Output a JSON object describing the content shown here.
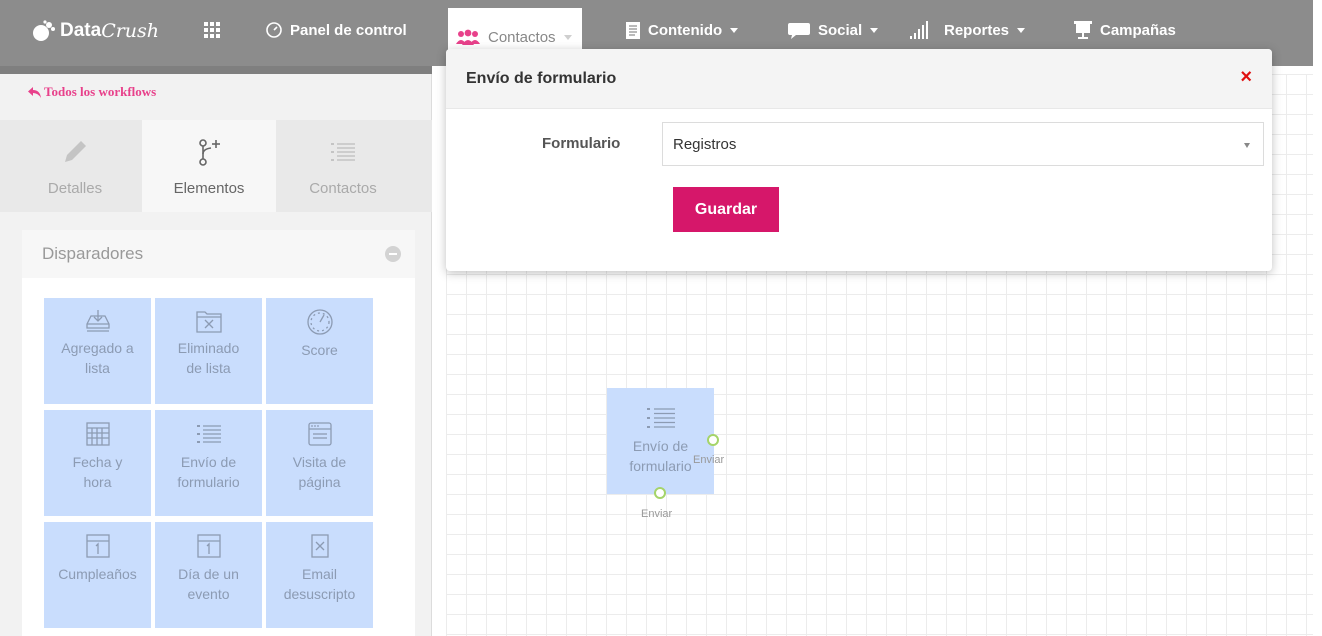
{
  "brand": {
    "name_a": "Data",
    "name_b": "Crush"
  },
  "nav": {
    "dashboard": "Panel de control",
    "contacts": "Contactos",
    "content": "Contenido",
    "social": "Social",
    "reports": "Reportes",
    "campaigns": "Campañas"
  },
  "sidebar": {
    "back_label": "Todos los workflows",
    "tabs": [
      {
        "label": "Detalles"
      },
      {
        "label": "Elementos"
      },
      {
        "label": "Contactos"
      }
    ],
    "section_title": "Disparadores",
    "tiles": [
      {
        "line1": "Agregado a",
        "line2": "lista",
        "icon": "inbox-download-icon"
      },
      {
        "line1": "Eliminado",
        "line2": "de lista",
        "icon": "folder-remove-icon"
      },
      {
        "line1": "Score",
        "line2": "",
        "icon": "gauge-icon"
      },
      {
        "line1": "Fecha y",
        "line2": "hora",
        "icon": "calendar-grid-icon"
      },
      {
        "line1": "Envío de",
        "line2": "formulario",
        "icon": "list-icon"
      },
      {
        "line1": "Visita de",
        "line2": "página",
        "icon": "browser-window-icon"
      },
      {
        "line1": "Cumpleaños",
        "line2": "",
        "icon": "calendar-one-icon"
      },
      {
        "line1": "Día de un",
        "line2": "evento",
        "icon": "calendar-one-icon"
      },
      {
        "line1": "Email",
        "line2": "desuscripto",
        "icon": "document-x-icon"
      }
    ]
  },
  "canvas": {
    "node": {
      "line1": "Envío de",
      "line2": "formulario"
    },
    "right_anchor_label": "Enviar",
    "bottom_anchor_label": "Enviar"
  },
  "modal": {
    "title": "Envío de formulario",
    "close": "×",
    "field_label": "Formulario",
    "select_value": "Registros",
    "save_label": "Guardar"
  },
  "colors": {
    "accent": "#d6176a",
    "link": "#e8418b",
    "tile": "#c9ddfd",
    "anchor": "#a5d46a"
  }
}
